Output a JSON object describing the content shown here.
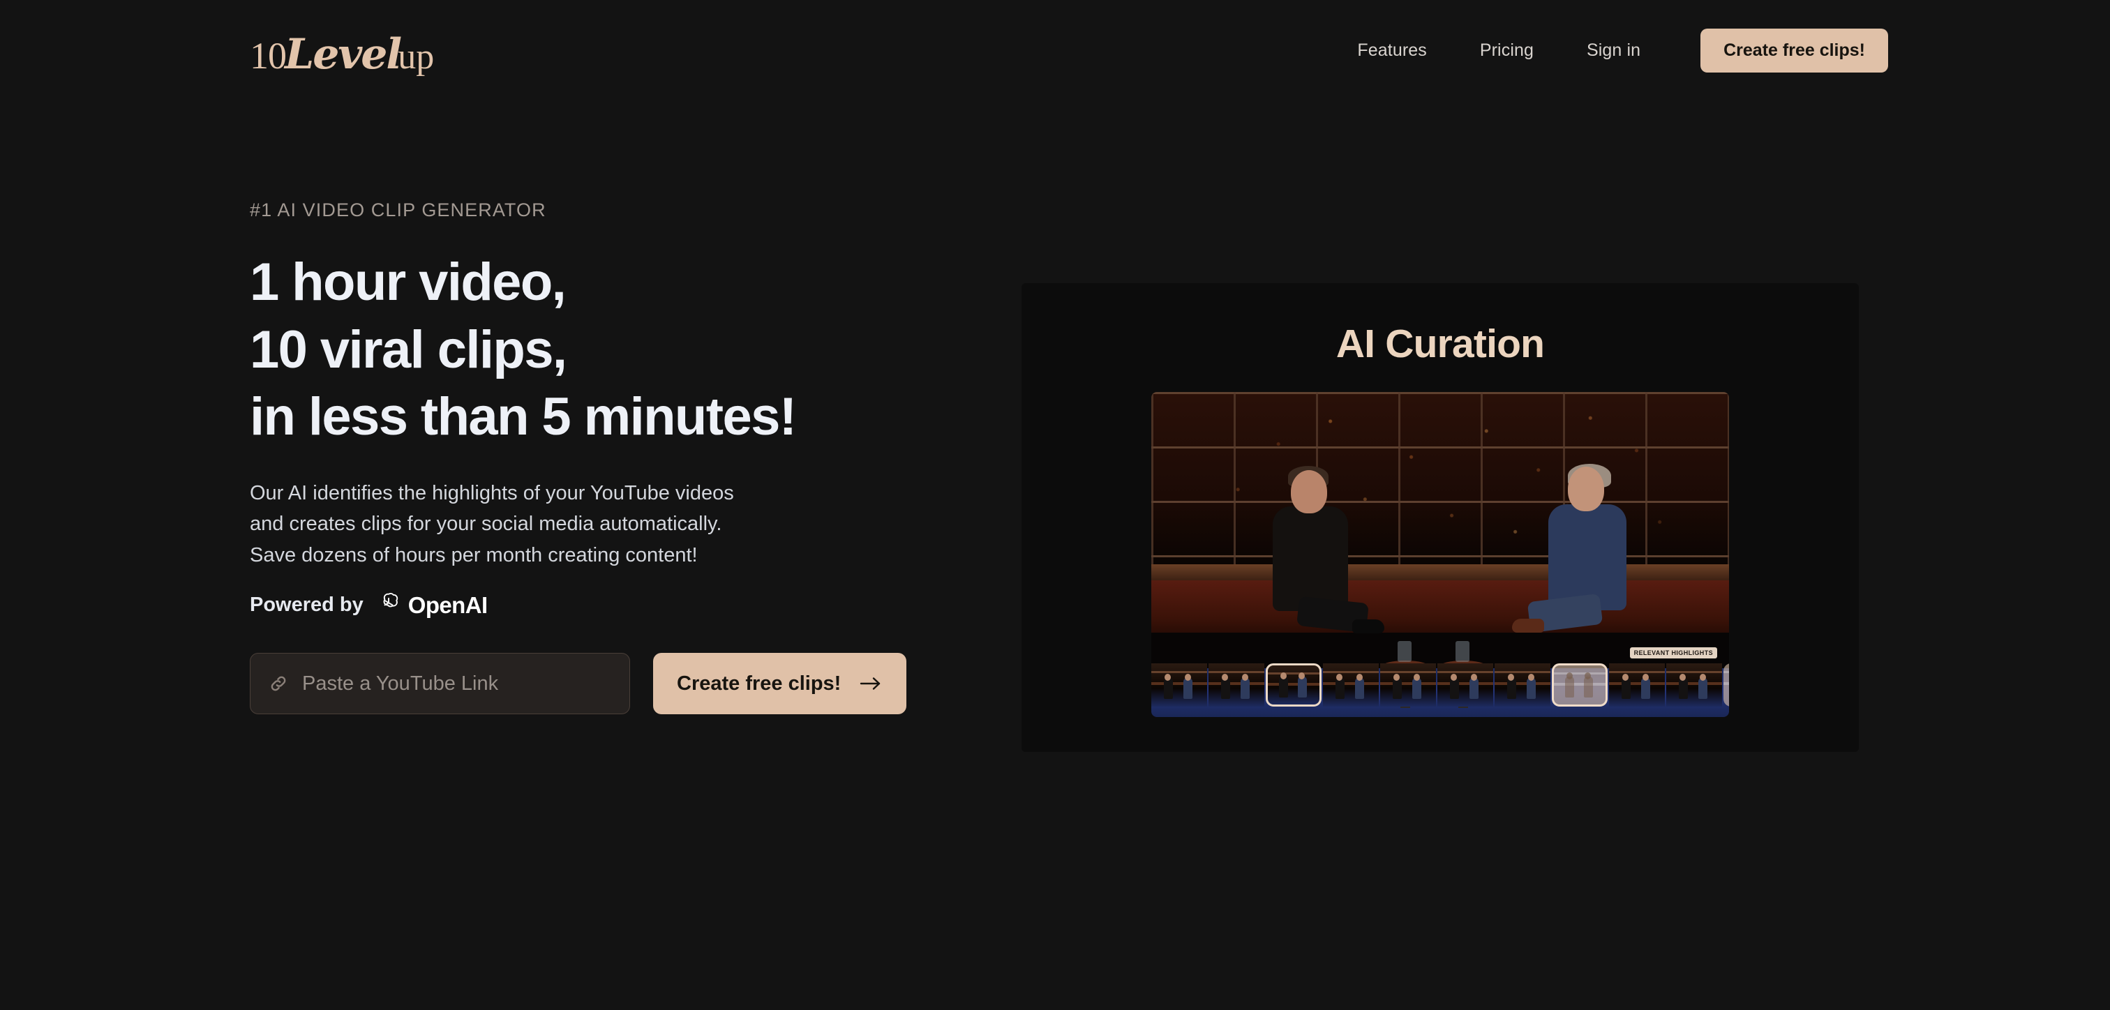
{
  "brand": {
    "logo_num": "10",
    "logo_script": "Level",
    "logo_suffix": "up"
  },
  "nav": {
    "links": [
      {
        "label": "Features",
        "name": "nav-link-features"
      },
      {
        "label": "Pricing",
        "name": "nav-link-pricing"
      },
      {
        "label": "Sign in",
        "name": "nav-link-sign-in"
      }
    ],
    "cta_label": "Create free clips!",
    "cta_color": "#e0c1a8"
  },
  "hero": {
    "eyebrow": "#1 AI VIDEO CLIP GENERATOR",
    "headline_lines": [
      "1 hour video,",
      "10 viral clips,",
      "in less than 5 minutes!"
    ],
    "subcopy_lines": [
      "Our AI identifies the highlights of your YouTube videos",
      "and creates clips for your social media automatically.",
      "Save dozens of hours per month creating content!"
    ],
    "powered_by_label": "Powered by",
    "powered_by_brand": "OpenAI",
    "input_placeholder": "Paste a YouTube Link",
    "input_value": "",
    "input_icon": "link-icon",
    "cta_label": "Create free clips!",
    "cta_icon": "arrow-right-icon"
  },
  "showcase": {
    "title": "AI Curation",
    "title_color": "#ecd5bf",
    "badge_label": "RELEVANT HIGHLIGHTS",
    "video_description": "Two men seated in armchairs on a late-night talk show set, facing each other, with a night-time city skyline visible through the studio windows and a blue stage floor.",
    "filmstrip_frames": [
      {
        "state": "normal"
      },
      {
        "state": "normal"
      },
      {
        "state": "selected"
      },
      {
        "state": "normal"
      },
      {
        "state": "normal"
      },
      {
        "state": "normal"
      },
      {
        "state": "normal"
      },
      {
        "state": "ghost-outlined"
      },
      {
        "state": "normal"
      },
      {
        "state": "normal"
      },
      {
        "state": "ghost"
      }
    ]
  },
  "theme": {
    "page_background": "#131313",
    "panel_background": "#0c0c0c",
    "accent": "#e0c1a8",
    "headline_color": "#eef1f7"
  }
}
